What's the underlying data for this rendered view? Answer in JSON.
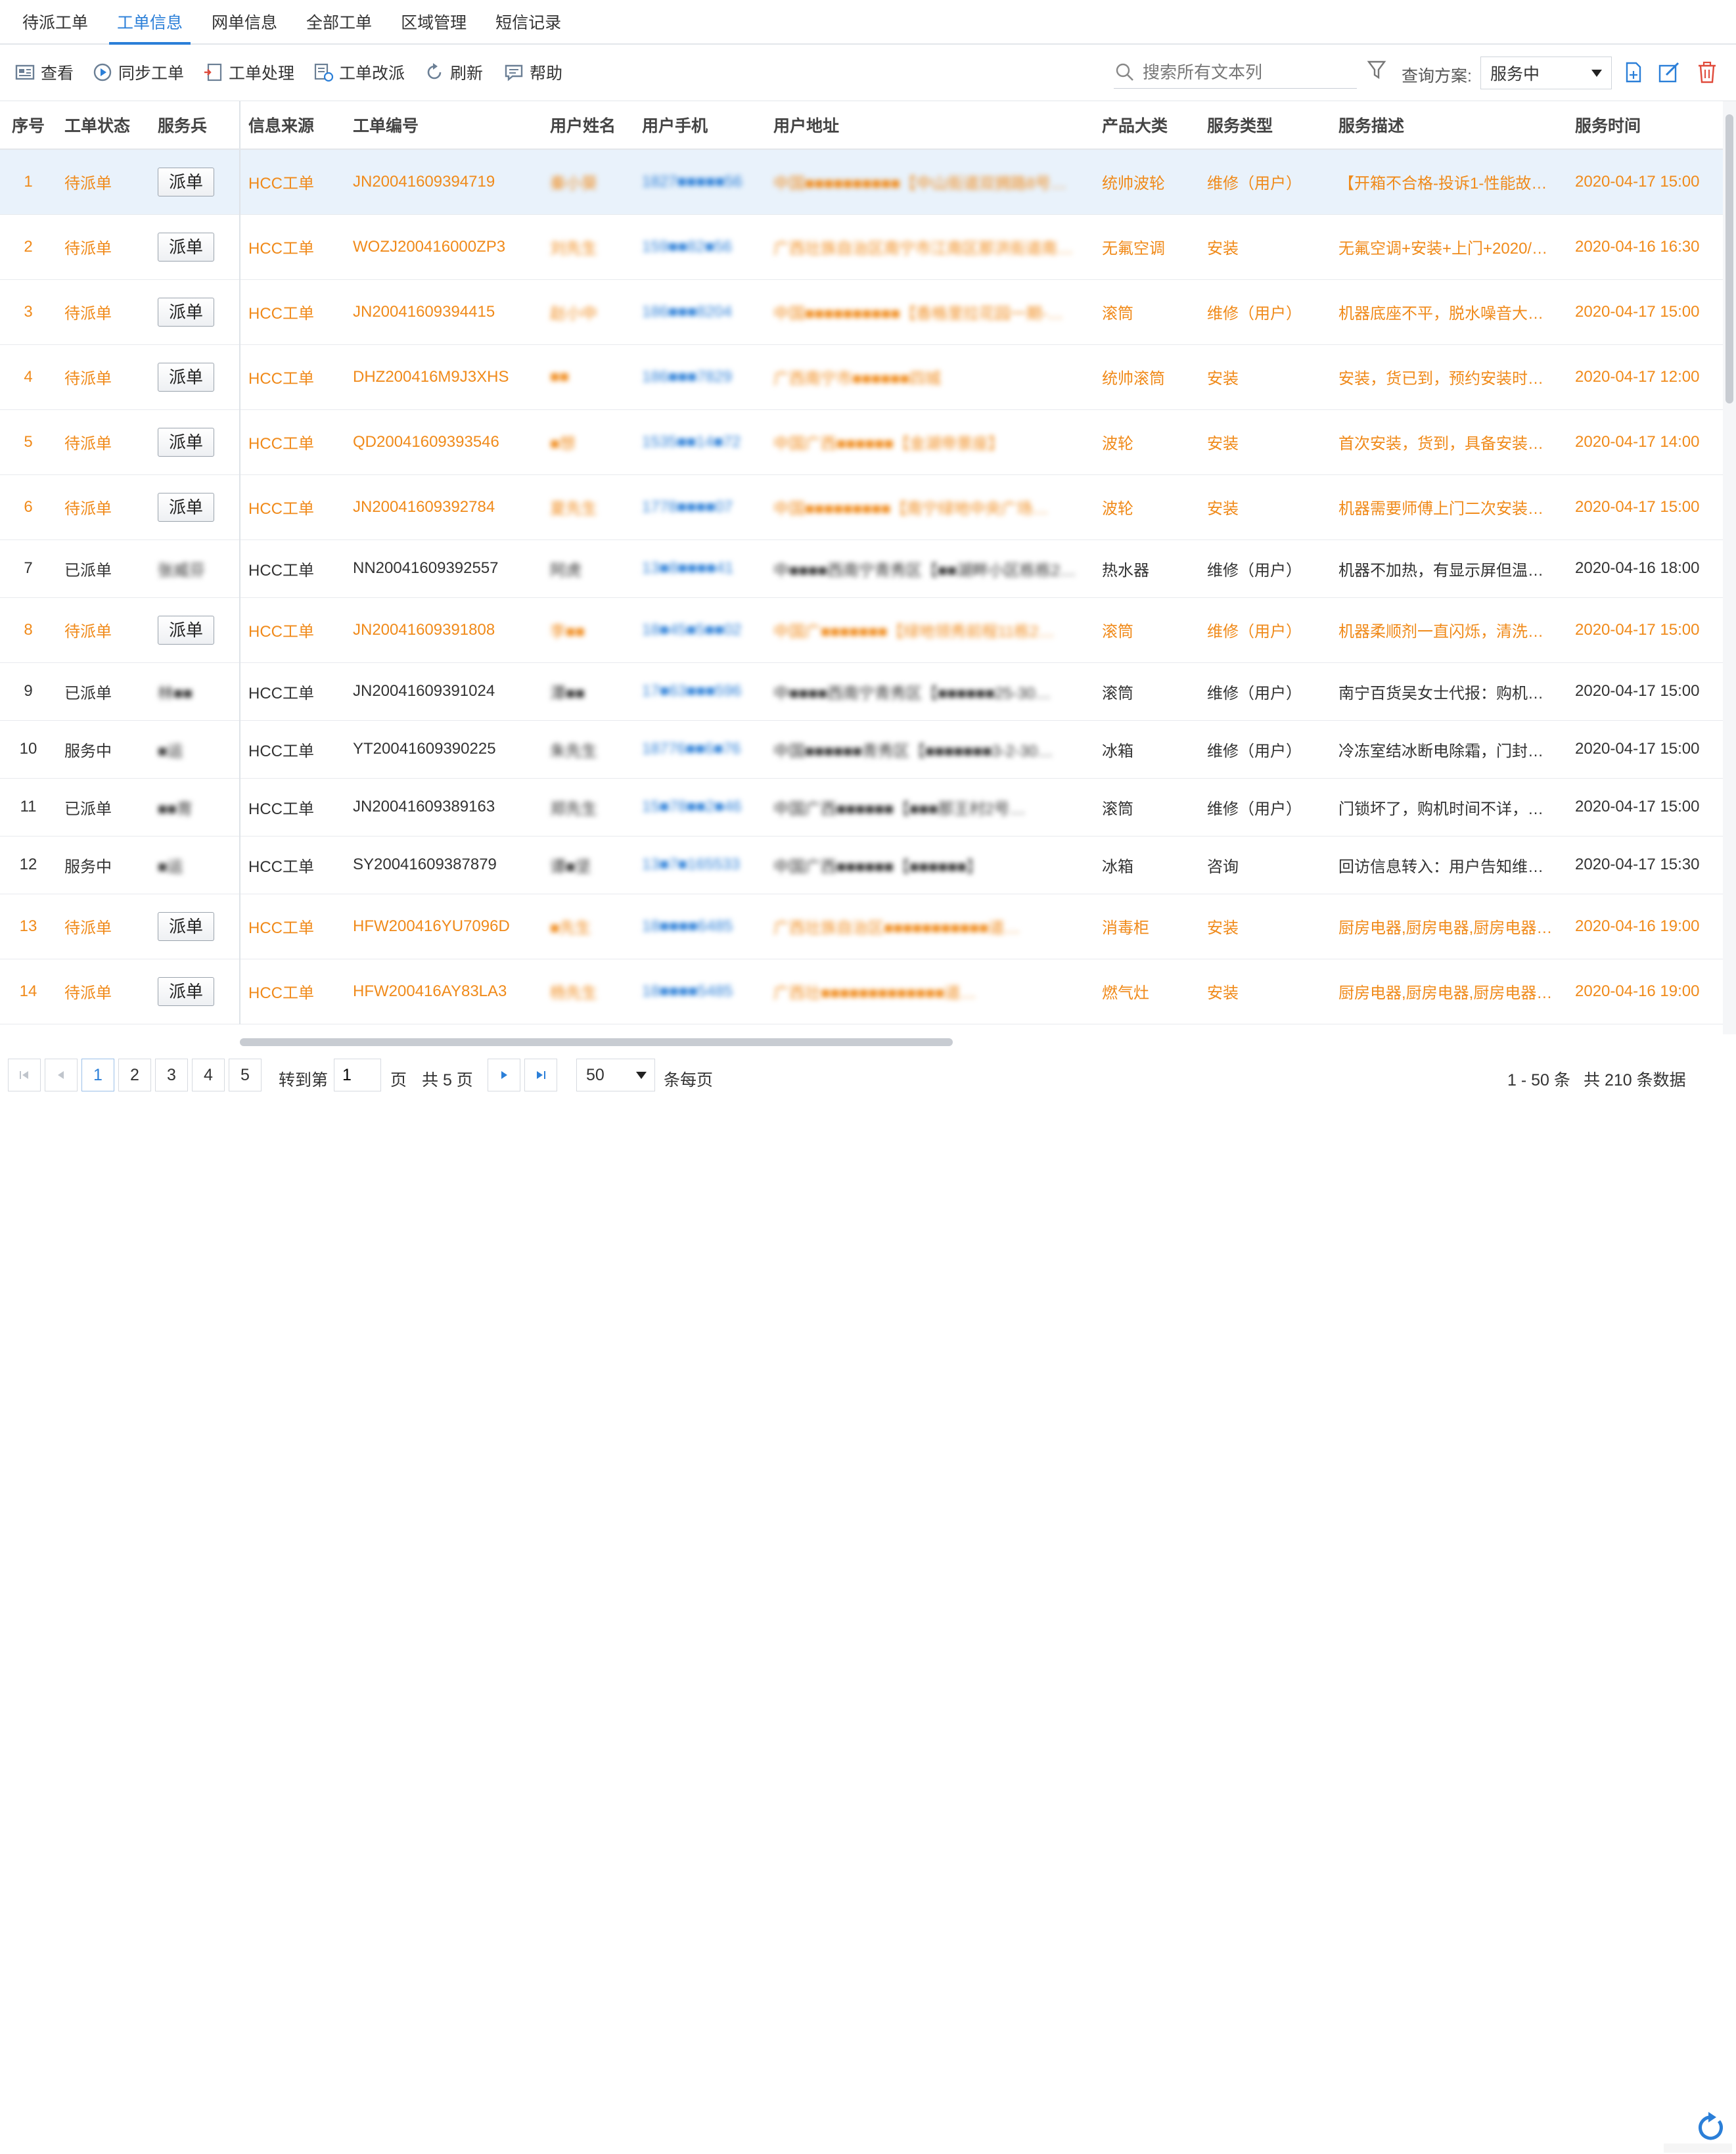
{
  "tabs": [
    "待派工单",
    "工单信息",
    "网单信息",
    "全部工单",
    "区域管理",
    "短信记录"
  ],
  "toolbar": {
    "view": "查看",
    "sync": "同步工单",
    "process": "工单处理",
    "reassign": "工单改派",
    "refresh": "刷新",
    "help": "帮助"
  },
  "search": {
    "placeholder": "搜索所有文本列"
  },
  "scheme": {
    "label": "查询方案:",
    "value": "服务中"
  },
  "columns": [
    "序号",
    "工单状态",
    "服务兵",
    "信息来源",
    "工单编号",
    "用户姓名",
    "用户手机",
    "用户地址",
    "产品大类",
    "服务类型",
    "服务描述",
    "服务时间"
  ],
  "dispatch_label": "派单",
  "rows": [
    {
      "idx": "1",
      "status": "待派单",
      "soldier": "",
      "source": "HCC工单",
      "no": "JN20041609394719",
      "name": "秦小葵",
      "phone": "1827■■■■■56",
      "address": "中国■■■■■■■■■■【中山街道双拥路8号…",
      "product": "统帅波轮",
      "type": "维修（用户）",
      "desc": "【开箱不合格-投诉1-性能故…",
      "time": "2020-04-17 15:00"
    },
    {
      "idx": "2",
      "status": "待派单",
      "soldier": "",
      "source": "HCC工单",
      "no": "WOZJ200416000ZP3",
      "name": "刘先生",
      "phone": "159■■82■56",
      "address": "广西壮族自治区南宁市江南区那洪街道南…",
      "product": "无氟空调",
      "type": "安装",
      "desc": "无氟空调+安装+上门+2020/…",
      "time": "2020-04-16 16:30"
    },
    {
      "idx": "3",
      "status": "待派单",
      "soldier": "",
      "source": "HCC工单",
      "no": "JN20041609394415",
      "name": "赵小中",
      "phone": "186■■■8204",
      "address": "中国■■■■■■■■■■【香格里拉花园一期-…",
      "product": "滚筒",
      "type": "维修（用户）",
      "desc": "机器底座不平，脱水噪音大…",
      "time": "2020-04-17 15:00"
    },
    {
      "idx": "4",
      "status": "待派单",
      "soldier": "",
      "source": "HCC工单",
      "no": "DHZ200416M9J3XHS",
      "name": "■■",
      "phone": "186■■■7829",
      "address": "广西南宁市■■■■■■四城",
      "product": "统帅滚筒",
      "type": "安装",
      "desc": "安装，货已到，预约安装时…",
      "time": "2020-04-17 12:00"
    },
    {
      "idx": "5",
      "status": "待派单",
      "soldier": "",
      "source": "HCC工单",
      "no": "QD20041609393546",
      "name": "■想",
      "phone": "1535■■14■72",
      "address": "中国广西■■■■■■【金湖帝景座】",
      "product": "波轮",
      "type": "安装",
      "desc": "首次安装，货到，具备安装…",
      "time": "2020-04-17 14:00"
    },
    {
      "idx": "6",
      "status": "待派单",
      "soldier": "",
      "source": "HCC工单",
      "no": "JN20041609392784",
      "name": "夏先生",
      "phone": "1778■■■■07",
      "address": "中国■■■■■■■■■【南宁绿地中央广场…",
      "product": "波轮",
      "type": "安装",
      "desc": "机器需要师傅上门二次安装…",
      "time": "2020-04-17 15:00"
    },
    {
      "idx": "7",
      "status": "已派单",
      "soldier": "张威芬",
      "source": "HCC工单",
      "no": "NN20041609392557",
      "name": "阿虎",
      "phone": "13■8■■■■41",
      "address": "中■■■■西南宁青秀区【■■湖畔小区栋栋2…",
      "product": "热水器",
      "type": "维修（用户）",
      "desc": "机器不加热，有显示屏但温…",
      "time": "2020-04-16 18:00"
    },
    {
      "idx": "8",
      "status": "待派单",
      "soldier": "",
      "source": "HCC工单",
      "no": "JN20041609391808",
      "name": "李■■",
      "phone": "18■45■5■■02",
      "address": "中国广■■■■■■■【绿地领秀前程11栋2…",
      "product": "滚筒",
      "type": "维修（用户）",
      "desc": "机器柔顺剂一直闪烁，清洗…",
      "time": "2020-04-17 15:00"
    },
    {
      "idx": "9",
      "status": "已派单",
      "soldier": "林■■",
      "source": "HCC工单",
      "no": "JN20041609391024",
      "name": "潭■■",
      "phone": "17■63■■■596",
      "address": "中■■■■西南宁青秀区【■■■■■■25-30…",
      "product": "滚筒",
      "type": "维修（用户）",
      "desc": "南宁百货吴女士代报：购机…",
      "time": "2020-04-17 15:00"
    },
    {
      "idx": "10",
      "status": "服务中",
      "soldier": "■运",
      "source": "HCC工单",
      "no": "YT20041609390225",
      "name": "朱先生",
      "phone": "18776■■6■76",
      "address": "中国■■■■■■青秀区【■■■■■■■3-2-30…",
      "product": "冰箱",
      "type": "维修（用户）",
      "desc": "冷冻室结冰断电除霜，门封…",
      "time": "2020-04-17 15:00"
    },
    {
      "idx": "11",
      "status": "已派单",
      "soldier": "■■育",
      "source": "HCC工单",
      "no": "JN20041609389163",
      "name": "郑先生",
      "phone": "15■78■■2■46",
      "address": "中国广西■■■■■■【■■■那王村2号…",
      "product": "滚筒",
      "type": "维修（用户）",
      "desc": "门锁坏了，购机时间不详，…",
      "time": "2020-04-17 15:00"
    },
    {
      "idx": "12",
      "status": "服务中",
      "soldier": "■运",
      "source": "HCC工单",
      "no": "SY20041609387879",
      "name": "谭■坚",
      "phone": "13■7■165533",
      "address": "中国广西■■■■■■【■■■■■■】",
      "product": "冰箱",
      "type": "咨询",
      "desc": "回访信息转入：用户告知维…",
      "time": "2020-04-17 15:30"
    },
    {
      "idx": "13",
      "status": "待派单",
      "soldier": "",
      "source": "HCC工单",
      "no": "HFW200416YU7096D",
      "name": "■先生",
      "phone": "18■■■■6485",
      "address": "广西壮族自治区■■■■■■■■■■■道…",
      "product": "消毒柜",
      "type": "安装",
      "desc": "厨房电器,厨房电器,厨房电器…",
      "time": "2020-04-16 19:00"
    },
    {
      "idx": "14",
      "status": "待派单",
      "soldier": "",
      "source": "HCC工单",
      "no": "HFW200416AY83LA3",
      "name": "杨先生",
      "phone": "18■■■■5485",
      "address": "广西壮■■■■■■■■■■■■■道…",
      "product": "燃气灶",
      "type": "安装",
      "desc": "厨房电器,厨房电器,厨房电器…",
      "time": "2020-04-16 19:00"
    }
  ],
  "pager": {
    "pages": [
      "1",
      "2",
      "3",
      "4",
      "5"
    ],
    "goto_label": "转到第",
    "goto_value": "1",
    "page_unit": "页",
    "total_pages": "共 5 页",
    "page_size": "50",
    "per_page": "条每页",
    "range": "1 - 50 条",
    "total": "共 210 条数据"
  },
  "colors": {
    "accent": "#2b7fd8",
    "pending": "#f08a1a",
    "selected_row": "#e9f2fb"
  }
}
